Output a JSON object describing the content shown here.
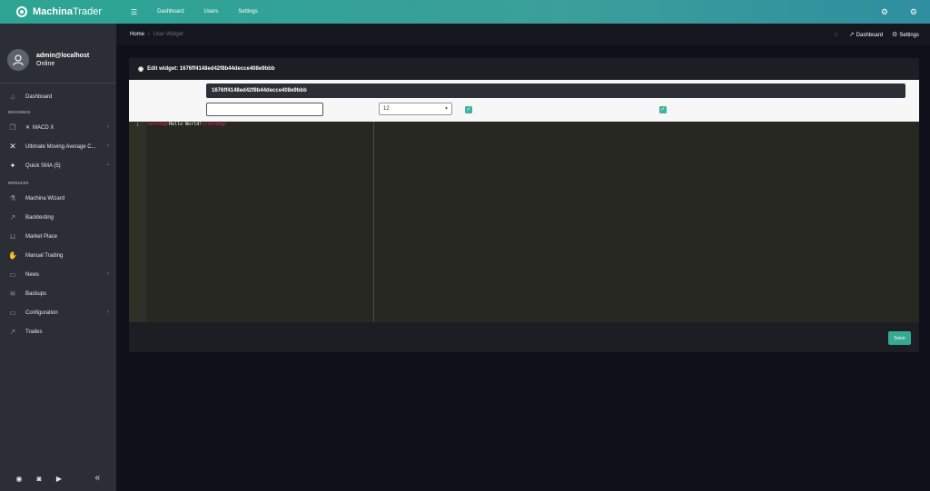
{
  "brand": {
    "name_bold": "Machina",
    "name_rest": "Trader"
  },
  "user": {
    "name": "admin@localhost",
    "status": "Online"
  },
  "sidebar": {
    "dashboard": "Dashboard",
    "machinas_heading": "MACHINAS",
    "machinas": [
      {
        "label": "MACD X"
      },
      {
        "label": "Ultimate Moving Average C..."
      },
      {
        "label": "Quick SMA (5)"
      }
    ],
    "modules_heading": "MODULES",
    "modules": [
      {
        "label": "Machina Wizard"
      },
      {
        "label": "Backtesting"
      },
      {
        "label": "Market Place"
      },
      {
        "label": "Manual Trading"
      },
      {
        "label": "News"
      },
      {
        "label": "Backups"
      },
      {
        "label": "Configuration"
      },
      {
        "label": "Trades"
      }
    ]
  },
  "topbar": {
    "links": [
      "Dashboard",
      "Users",
      "Settings"
    ]
  },
  "breadcrumb": {
    "home": "Home",
    "current": "User Widget",
    "right_links": [
      "Dashboard",
      "Settings"
    ]
  },
  "card": {
    "title": "Edit widget: 1676ff4148ed42f8b44decce408e9bbb",
    "form": {
      "name_value": "1676ff4148ed42f8b44decce408e9bbb",
      "size_value": "12",
      "checkbox1_checked": true,
      "checkbox2_checked": true
    },
    "editor": {
      "line_number": "1",
      "code_open": "<strong>",
      "code_text": "Hello World!",
      "code_close": "</strong>"
    },
    "save_label": "Save"
  },
  "colors": {
    "accent": "#2ea495",
    "sidebar": "#2b2f35",
    "background": "#0f111a",
    "editor_bg": "#272822"
  }
}
